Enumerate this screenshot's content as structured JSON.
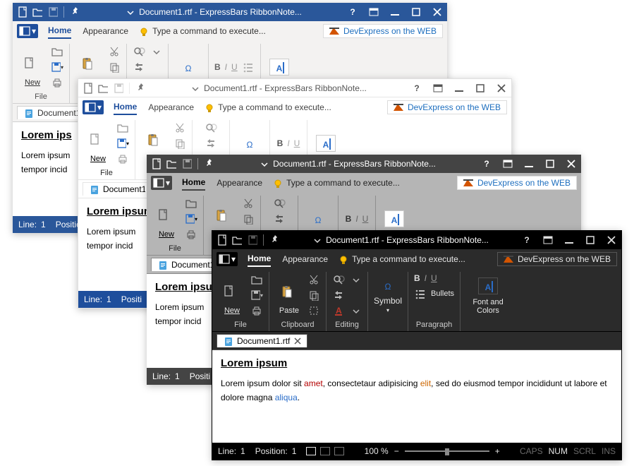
{
  "title": "Document1.rtf - ExpressBars RibbonNote...",
  "tellme": "Type a command to execute...",
  "webbox": "DevExpress on the WEB",
  "tabs": {
    "home": "Home",
    "appearance": "Appearance"
  },
  "groups": {
    "file": "File",
    "clipboard": "Clipboard",
    "editing": "Editing",
    "symbol": "Symbol",
    "font": "Font",
    "paragraph": "Paragraph",
    "fontcolors": "Font and Colors"
  },
  "buttons": {
    "new": "New",
    "paste": "Paste",
    "symbol": "Symbol",
    "bullets": "Bullets",
    "fontcolors": "Font and\nColors"
  },
  "format": {
    "bold": "B",
    "italic": "I",
    "underline": "U"
  },
  "textcolor_glyph": "A",
  "doctab": {
    "name": "Document1.rtf"
  },
  "heading": "Lorem ipsum",
  "para_plain_1": "Lorem ipsum dolor sit amet, consectetaur adipisicing elit, sed do eiusmod tempor incididunt ut labore et dolore magna aliqua.",
  "para_frag": {
    "a": "Lorem ipsum dolor sit ",
    "amet": "amet",
    "b": ", consectetaur adipisicing ",
    "elit": "elit",
    "c": ", sed do eiusmod tempor incididunt ut labore et dolore magna ",
    "aliqua": "aliqua",
    "d": "."
  },
  "heading_cut": "Lorem ips",
  "para_cut1": "Lorem ipsum",
  "para_cut2": "tempor incid",
  "heading_cut2": "Lorem ipsum",
  "para_cut3": "Lorem ipsum",
  "para_cut4": "tempor incid",
  "status": {
    "line_label": "Line:",
    "line": "1",
    "pos_label": "Position:",
    "pos": "1",
    "pos_label_cut": "Positio",
    "pos_label_cut2": "Positi",
    "zoom": "100 %",
    "caps": "CAPS",
    "num": "NUM",
    "scrl": "SCRL",
    "ins": "INS"
  }
}
